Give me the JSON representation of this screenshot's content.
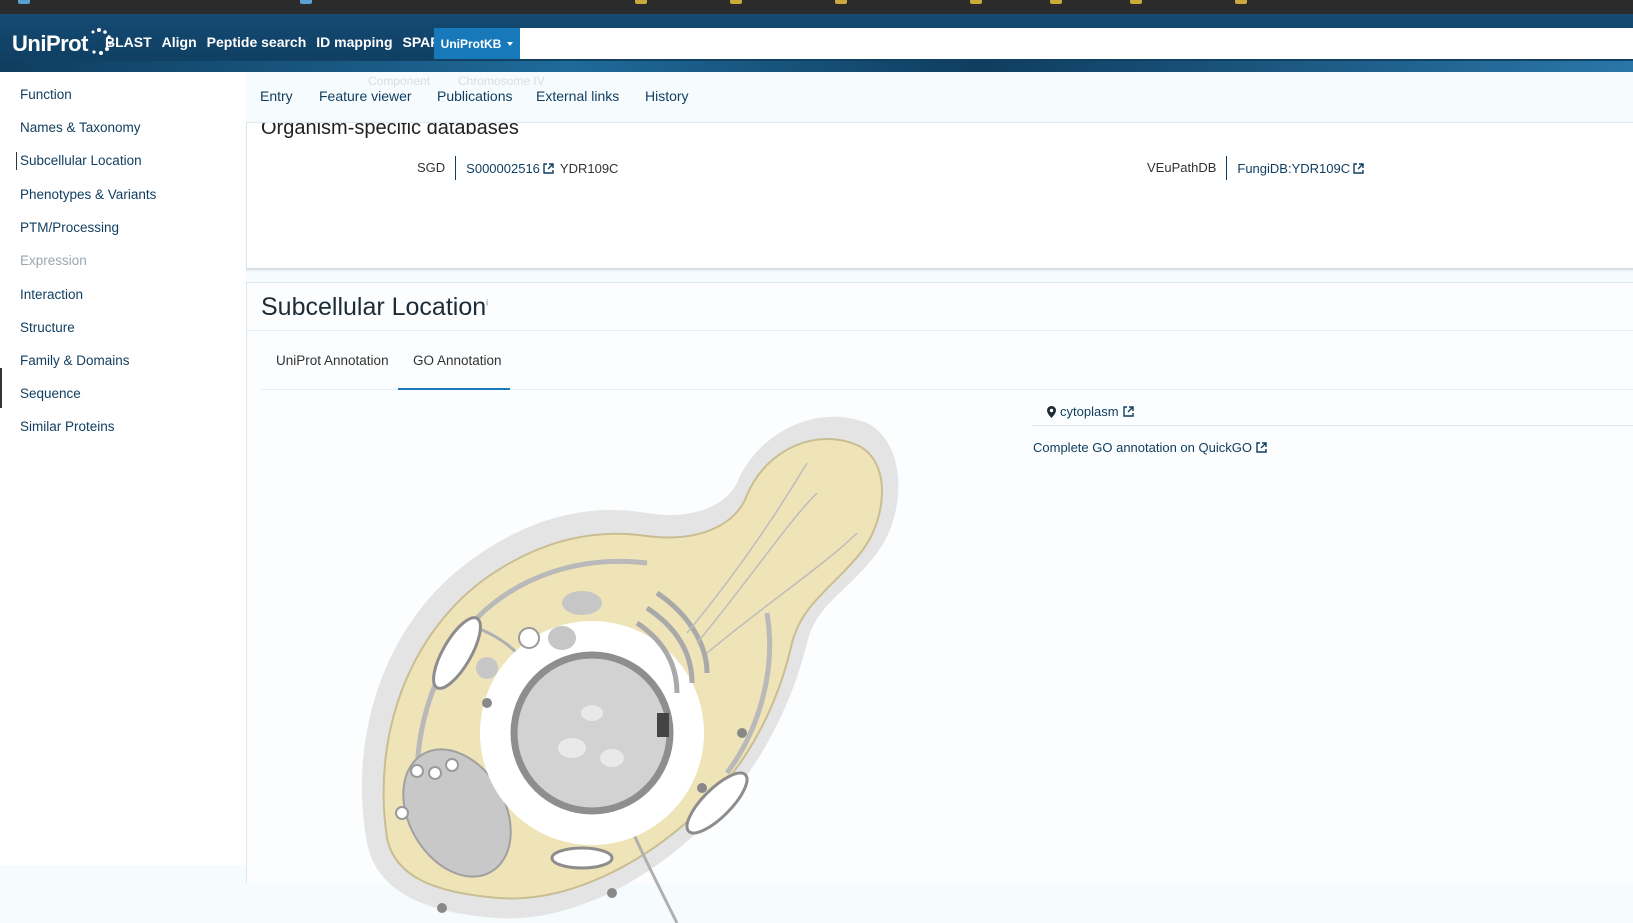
{
  "header": {
    "logo": "UniProt",
    "nav": [
      "BLAST",
      "Align",
      "Peptide search",
      "ID mapping",
      "SPARQL"
    ],
    "db_select": "UniProtKB",
    "search_value": ""
  },
  "sidebar": {
    "items": [
      {
        "label": "Function"
      },
      {
        "label": "Names & Taxonomy"
      },
      {
        "label": "Subcellular Location"
      },
      {
        "label": "Phenotypes & Variants"
      },
      {
        "label": "PTM/Processing"
      },
      {
        "label": "Expression",
        "disabled": true
      },
      {
        "label": "Interaction"
      },
      {
        "label": "Structure"
      },
      {
        "label": "Family & Domains"
      },
      {
        "label": "Sequence"
      },
      {
        "label": "Similar Proteins"
      }
    ]
  },
  "tabs": [
    "Entry",
    "Feature viewer",
    "Publications",
    "External links",
    "History"
  ],
  "ghost_text": [
    "Component",
    "Chromosome IV"
  ],
  "organism_db": {
    "heading": "Organism-specific databases",
    "rows": [
      {
        "label": "SGD",
        "link": "S000002516",
        "sub": "YDR109C"
      },
      {
        "label": "VEuPathDB",
        "link": "FungiDB:YDR109C"
      }
    ]
  },
  "subcellular": {
    "title": "Subcellular Location",
    "info": "i",
    "subtabs": [
      "UniProt Annotation",
      "GO Annotation"
    ],
    "active_subtab": "GO Annotation",
    "location": "cytoplasm",
    "quickgo": "Complete GO annotation on QuickGO"
  },
  "colors": {
    "brand": "#0f3d5f",
    "accent": "#1779ba",
    "cytoplasm": "#efe3b8"
  }
}
